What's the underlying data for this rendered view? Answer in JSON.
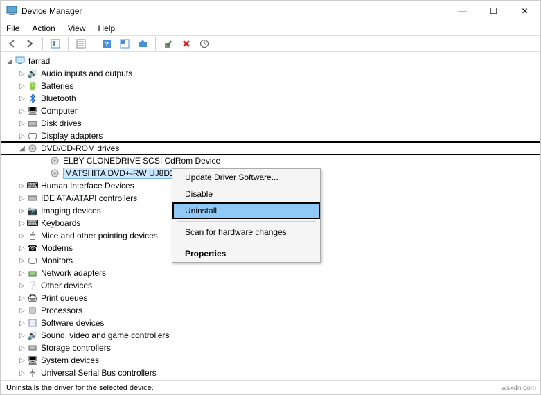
{
  "title": "Device Manager",
  "menu": {
    "file": "File",
    "action": "Action",
    "view": "View",
    "help": "Help"
  },
  "toolbar": {
    "back": "◄",
    "forward": "►"
  },
  "tree": {
    "root": "farrad",
    "items": [
      {
        "label": "Audio inputs and outputs"
      },
      {
        "label": "Batteries"
      },
      {
        "label": "Bluetooth"
      },
      {
        "label": "Computer"
      },
      {
        "label": "Disk drives"
      },
      {
        "label": "Display adapters"
      },
      {
        "label": "DVD/CD-ROM drives",
        "expanded": true,
        "highlight": true,
        "children": [
          {
            "label": "ELBY CLONEDRIVE SCSI CdRom Device"
          },
          {
            "label": "MATSHITA DVD+-RW UJ8D1",
            "selected": true
          }
        ]
      },
      {
        "label": "Human Interface Devices"
      },
      {
        "label": "IDE ATA/ATAPI controllers"
      },
      {
        "label": "Imaging devices"
      },
      {
        "label": "Keyboards"
      },
      {
        "label": "Mice and other pointing devices"
      },
      {
        "label": "Modems"
      },
      {
        "label": "Monitors"
      },
      {
        "label": "Network adapters"
      },
      {
        "label": "Other devices"
      },
      {
        "label": "Print queues"
      },
      {
        "label": "Processors"
      },
      {
        "label": "Software devices"
      },
      {
        "label": "Sound, video and game controllers"
      },
      {
        "label": "Storage controllers"
      },
      {
        "label": "System devices"
      },
      {
        "label": "Universal Serial Bus controllers"
      }
    ]
  },
  "contextMenu": {
    "update": "Update Driver Software...",
    "disable": "Disable",
    "uninstall": "Uninstall",
    "scan": "Scan for hardware changes",
    "properties": "Properties"
  },
  "status": "Uninstalls the driver for the selected device.",
  "footer": "wsxdn.com",
  "glyph": {
    "tri_closed": "▷",
    "tri_open": "◢",
    "min": "—",
    "max": "☐",
    "close": "✕"
  }
}
